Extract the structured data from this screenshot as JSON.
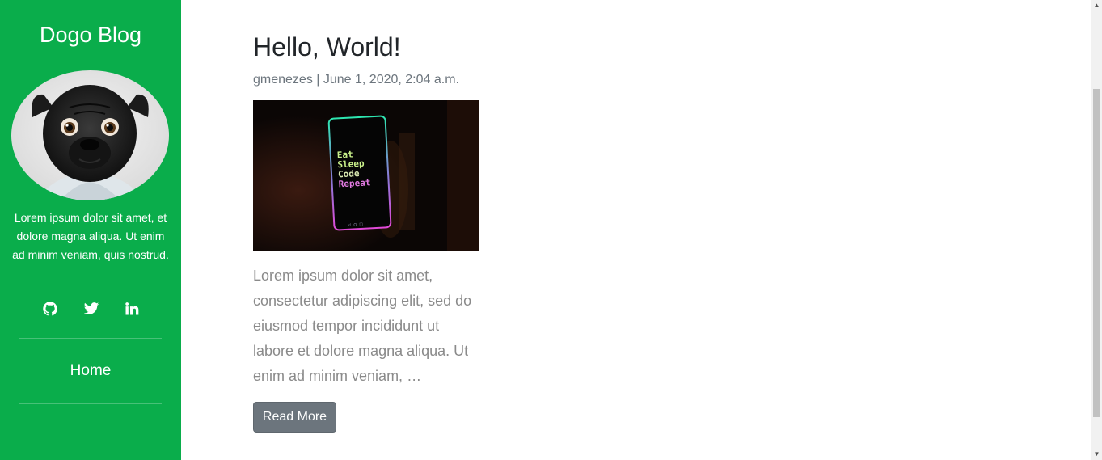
{
  "sidebar": {
    "title": "Dogo Blog",
    "avatar_icon": "pug-dog-photo",
    "bio": "Lorem ipsum dolor sit amet, et dolore magna aliqua. Ut enim ad minim veniam, quis nostrud.",
    "social": [
      {
        "icon": "github-icon"
      },
      {
        "icon": "twitter-icon"
      },
      {
        "icon": "linkedin-icon"
      }
    ],
    "nav": {
      "home_label": "Home"
    },
    "background_color": "#0aad4b"
  },
  "post": {
    "title": "Hello, World!",
    "meta": "gmenezes | June 1, 2020, 2:04 a.m.",
    "image": {
      "phone_lines": [
        "Eat",
        "Sleep",
        "Code",
        "Repeat"
      ]
    },
    "excerpt": "Lorem ipsum dolor sit amet, consectetur adipiscing elit, sed do eiusmod tempor incididunt ut labore et dolore magna aliqua. Ut enim ad minim veniam, …",
    "read_more_label": "Read More"
  },
  "scrollbar": {
    "up_arrow": "▲",
    "down_arrow": "▼"
  }
}
